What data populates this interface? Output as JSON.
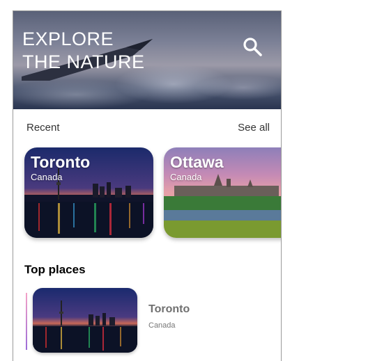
{
  "header": {
    "title_line1": "EXPLORE",
    "title_line2": "THE NATURE",
    "search_icon": "search-icon"
  },
  "recent": {
    "label": "Recent",
    "see_all": "See all",
    "cards": [
      {
        "name": "Toronto",
        "country": "Canada"
      },
      {
        "name": "Ottawa",
        "country": "Canada"
      }
    ]
  },
  "top_places": {
    "title": "Top places",
    "items": [
      {
        "name": "Toronto",
        "country": "Canada"
      }
    ]
  },
  "colors": {
    "accent_bar_top": "#f5a3c7",
    "accent_bar_bottom": "#9b6bd8",
    "place_name": "#707070"
  }
}
